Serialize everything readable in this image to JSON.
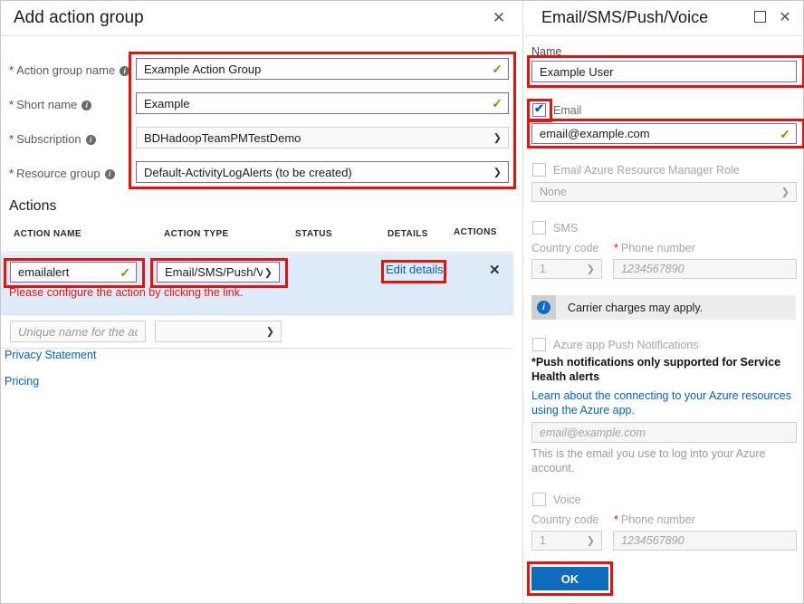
{
  "left_panel": {
    "title": "Add action group",
    "close_icon": "close-icon",
    "fields": [
      {
        "label": "Action group name",
        "required": true,
        "info": true,
        "value": "Example Action Group",
        "type": "text",
        "valid": true
      },
      {
        "label": "Short name",
        "required": true,
        "info": true,
        "value": "Example",
        "type": "text",
        "valid": true
      },
      {
        "label": "Subscription",
        "required": true,
        "info": true,
        "value": "BDHadoopTeamPMTestDemo",
        "type": "select",
        "valid": false
      },
      {
        "label": "Resource group",
        "required": true,
        "info": true,
        "value": "Default-ActivityLogAlerts (to be created)",
        "type": "select",
        "valid": false
      }
    ],
    "actions_section_title": "Actions",
    "table": {
      "headers": [
        "ACTION NAME",
        "ACTION TYPE",
        "STATUS",
        "DETAILS",
        "ACTIONS"
      ],
      "row": {
        "action_name": "emailalert",
        "action_type": "Email/SMS/Push/V...",
        "status": "",
        "details_link": "Edit details",
        "remove_icon": "close-icon",
        "error_message": "Please configure the action by clicking the link."
      },
      "new_row": {
        "name_placeholder": "Unique name for the act...",
        "type_value": ""
      }
    },
    "footer_links": [
      "Privacy Statement",
      "Pricing"
    ]
  },
  "right_panel": {
    "title": "Email/SMS/Push/Voice",
    "maximize_icon": "maximize-icon",
    "close_icon": "close-icon",
    "name_label": "Name",
    "name_value": "Example User",
    "email": {
      "checkbox_label": "Email",
      "checked": true,
      "value": "email@example.com",
      "valid": true
    },
    "arm_role": {
      "checkbox_label": "Email Azure Resource Manager Role",
      "checked": false,
      "select_value": "None"
    },
    "sms": {
      "checkbox_label": "SMS",
      "checked": false,
      "country_code_label": "Country code",
      "country_code_value": "1",
      "phone_label": "Phone number",
      "phone_required": true,
      "phone_placeholder": "1234567890"
    },
    "carrier_banner": {
      "icon": "info-icon",
      "text": "Carrier charges may apply."
    },
    "push": {
      "checkbox_label": "Azure app Push Notifications",
      "checked": false,
      "note": "*Push notifications only supported for Service Health alerts",
      "link": "Learn about the connecting to your Azure resources using the Azure app.",
      "email_placeholder": "email@example.com",
      "help_text": "This is the email you use to log into your Azure account."
    },
    "voice": {
      "checkbox_label": "Voice",
      "checked": false,
      "country_code_label": "Country code",
      "country_code_value": "1",
      "phone_label": "Phone number",
      "phone_required": true,
      "phone_placeholder": "1234567890"
    },
    "ok_button": "OK"
  },
  "colors": {
    "highlight_red": "#e8120b",
    "field_border": "#8a5fa8",
    "link_blue": "#0063c1",
    "valid_green": "#5ea500",
    "row_highlight": "#deecf9",
    "primary_button": "#0f6cbd"
  }
}
